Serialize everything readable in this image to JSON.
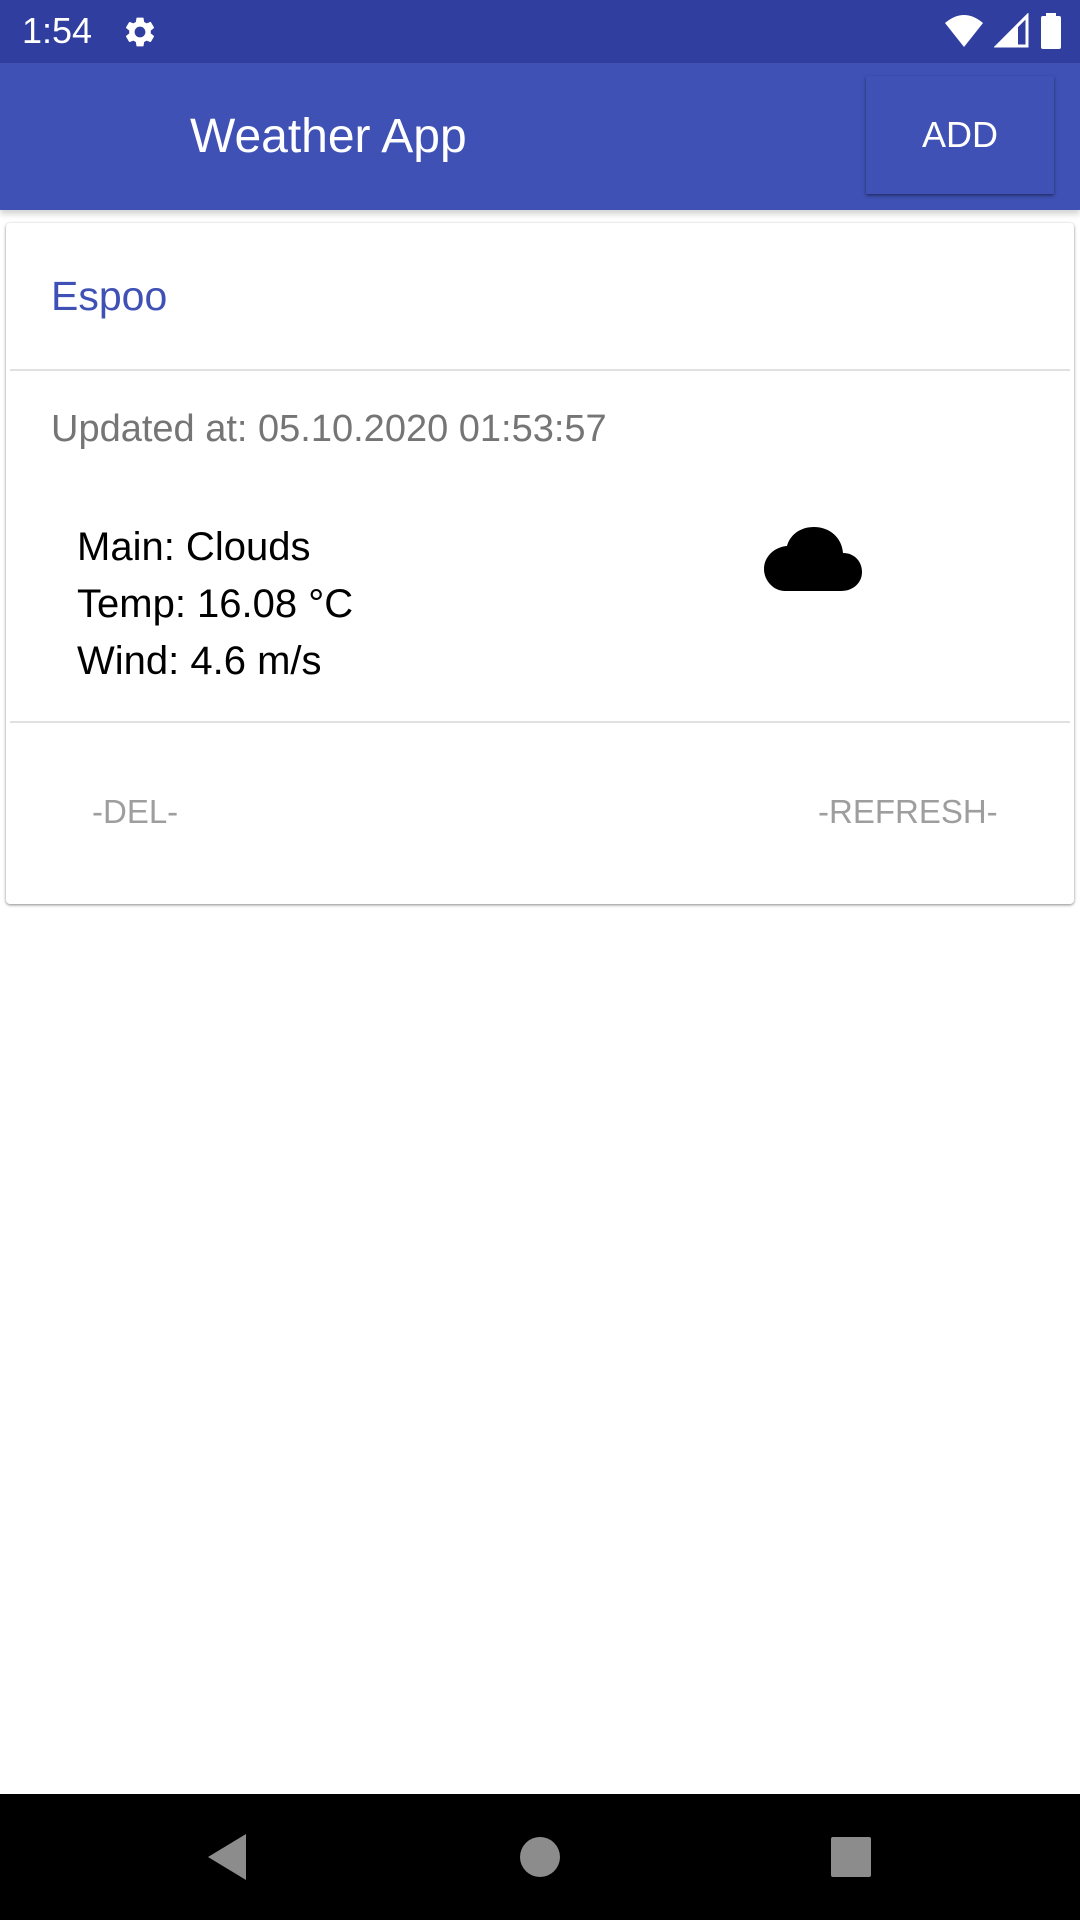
{
  "status_bar": {
    "time": "1:54",
    "icons": [
      "gear-icon",
      "wifi-icon",
      "signal-icon",
      "battery-icon"
    ]
  },
  "app_bar": {
    "title": "Weather App",
    "add_label": "ADD"
  },
  "card": {
    "city": "Espoo",
    "updated": "Updated at: 05.10.2020 01:53:57",
    "main": "Main: Clouds",
    "temp": "Temp: 16.08 °C",
    "wind": "Wind: 4.6 m/s",
    "weather_icon": "cloud-icon",
    "del_label": "-DEL-",
    "refresh_label": "-REFRESH-"
  },
  "nav_bar": {
    "icons": [
      "back-icon",
      "home-icon",
      "recents-icon"
    ]
  },
  "colors": {
    "status_bar": "#303f9f",
    "primary": "#3f51b5",
    "secondary_text": "#757575",
    "action_text": "#9e9e9e"
  }
}
